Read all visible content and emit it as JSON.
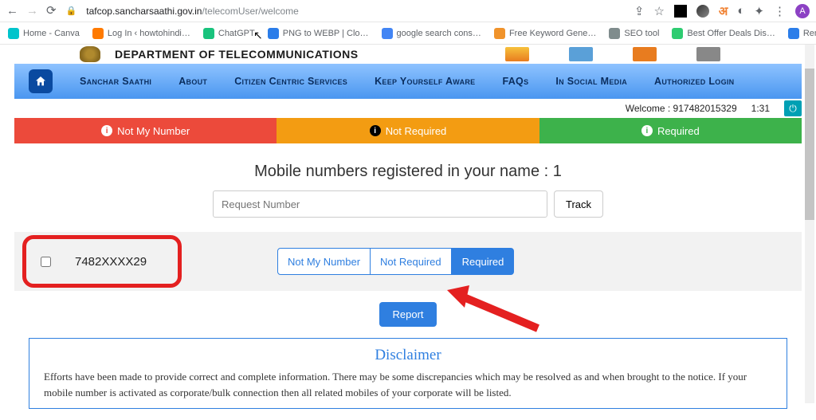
{
  "browser": {
    "url_host": "tafcop.sancharsaathi.gov.in",
    "url_path": "/telecomUser/welcome",
    "profile_initial": "A"
  },
  "bookmarks": [
    {
      "label": "Home - Canva",
      "color": "#00c4cc"
    },
    {
      "label": "Log In ‹ howtohindi…",
      "color": "#ff7a00"
    },
    {
      "label": "ChatGPT",
      "color": "#19c37d"
    },
    {
      "label": "PNG to WEBP | Clo…",
      "color": "#2b7de9"
    },
    {
      "label": "google search cons…",
      "color": "#4285f4"
    },
    {
      "label": "Free Keyword Gene…",
      "color": "#f0932b"
    },
    {
      "label": "SEO tool",
      "color": "#7f8c8d"
    },
    {
      "label": "Best Offer Deals Dis…",
      "color": "#2ecc71"
    },
    {
      "label": "Remove Bg: Upload…",
      "color": "#2b7de9"
    }
  ],
  "dept_title": "DEPARTMENT OF TELECOMMUNICATIONS",
  "nav": [
    "Sanchar Saathi",
    "About",
    "Citizen Centric Services",
    "Keep Yourself Aware",
    "FAQs",
    "In Social Media",
    "Authorized Login"
  ],
  "welcome": {
    "label": "Welcome : 917482015329",
    "time": "1:31"
  },
  "tabs": {
    "red": "Not My Number",
    "orange": "Not Required",
    "green": "Required"
  },
  "heading": "Mobile numbers registered in your name : 1",
  "request_placeholder": "Request Number",
  "track_label": "Track",
  "number": "7482XXXX29",
  "btns": {
    "a": "Not My Number",
    "b": "Not Required",
    "c": "Required"
  },
  "report": "Report",
  "disclaimer": {
    "title": "Disclaimer",
    "body": "Efforts have been made to provide correct and complete information. There may be some discrepancies which may be resolved as and when brought to the notice. If your mobile number is activated as corporate/bulk connection then all related mobiles of your corporate will be listed."
  }
}
